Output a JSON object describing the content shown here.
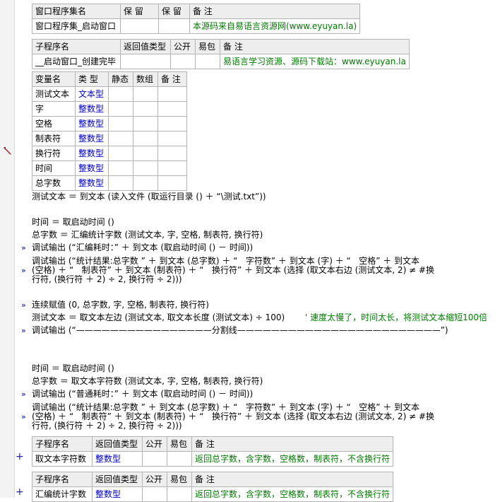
{
  "prog_set_table": {
    "headers": [
      "窗口程序集名",
      "保 留",
      "保 留",
      "备 注"
    ],
    "row": [
      "窗口程序集_启动窗口",
      "",
      "",
      "本源码来自易语言资源网(www.eyuyan.la)"
    ]
  },
  "sub_table_1": {
    "headers": [
      "子程序名",
      "返回值类型",
      "公开",
      "易包",
      "备 注"
    ],
    "row": [
      "__启动窗口_创建完毕",
      "",
      "",
      "",
      "易语言学习资源、源码下载站：www.eyuyan.la"
    ]
  },
  "var_table": {
    "headers": [
      "变量名",
      "类 型",
      "静态",
      "数组",
      "备 注"
    ],
    "rows": [
      [
        "测试文本",
        "文本型"
      ],
      [
        "字",
        "整数型"
      ],
      [
        "空格",
        "整数型"
      ],
      [
        "制表符",
        "整数型"
      ],
      [
        "换行符",
        "整数型"
      ],
      [
        "时间",
        "整数型"
      ],
      [
        "总字数",
        "整数型"
      ]
    ]
  },
  "code_lines": {
    "l1": "测试文本 ＝ 到文本 (读入文件 (取运行目录 () ＋ “\\测试.txt”))",
    "l2": "时间 ＝ 取启动时间 ()",
    "l3": "总字数 ＝ 汇编统计字数 (测试文本, 字, 空格, 制表符, 换行符)",
    "l4": "调试输出 (“汇编耗时：” ＋ 到文本 (取启动时间 () － 时间))",
    "l5a": "调试输出 (“统计结果:总字数 ” ＋ 到文本 (总字数) ＋ “   字符数” ＋ 到文本 (字) ＋ “   空格” ＋ 到文本",
    "l5b": "(空格) ＋ “   制表符” ＋ 到文本 (制表符) ＋ “   换行符” ＋ 到文本 (选择 (取文本右边 (测试文本, 2) ≠ #换",
    "l5c": "行符, (换行符 ＋ 2) ÷ 2, 换行符 ÷ 2)))",
    "l6": "连续赋值 (0, 总字数, 字, 空格, 制表符, 换行符)",
    "l7a": "测试文本 ＝ 取文本左边 (测试文本, 取文本长度 (测试文本) ÷ 100)",
    "l7c": "' 速度太慢了，时间太长，将测试文本缩短100倍",
    "l8": "调试输出 (“————————————————分割线————————————————————————”)",
    "l9": "时间 ＝ 取启动时间 ()",
    "l10": "总字数 ＝ 取文本字符数 (测试文本, 字, 空格, 制表符, 换行符)",
    "l11": "调试输出 (“普通耗时：” ＋ 到文本 (取启动时间 () － 时间))",
    "l12a": "调试输出 (“统计结果:总字数 ” ＋ 到文本 (总字数) ＋ “   字符数” ＋ 到文本 (字) ＋ “   空格” ＋ 到文本",
    "l12b": "(空格) ＋ “   制表符” ＋ 到文本 (制表符) ＋ “   换行符” ＋ 到文本 (选择 (取文本右边 (测试文本, 2) ≠ #换",
    "l12c": "行符, (换行符 ＋ 2) ÷ 2, 换行符 ÷ 2)))"
  },
  "sub_table_2": {
    "headers": [
      "子程序名",
      "返回值类型",
      "公开",
      "易包",
      "备 注"
    ],
    "row": [
      "取文本字符数",
      "整数型",
      "",
      "",
      "返回总字数，含字数，空格数，制表符，不含换行符"
    ]
  },
  "sub_table_3": {
    "headers": [
      "子程序名",
      "返回值类型",
      "公开",
      "易包",
      "备 注"
    ],
    "row": [
      "汇编统计字数",
      "整数型",
      "",
      "",
      "返回总字数，含字数，空格数，制表符，不含换行符"
    ]
  },
  "icons": {
    "pencil": "pencil-icon",
    "expand": "plus-expand-icon",
    "arrow": "debug-arrow-icon"
  },
  "colors": {
    "type": "#0000c0",
    "comment": "#007a00",
    "function": "#8b0000"
  }
}
